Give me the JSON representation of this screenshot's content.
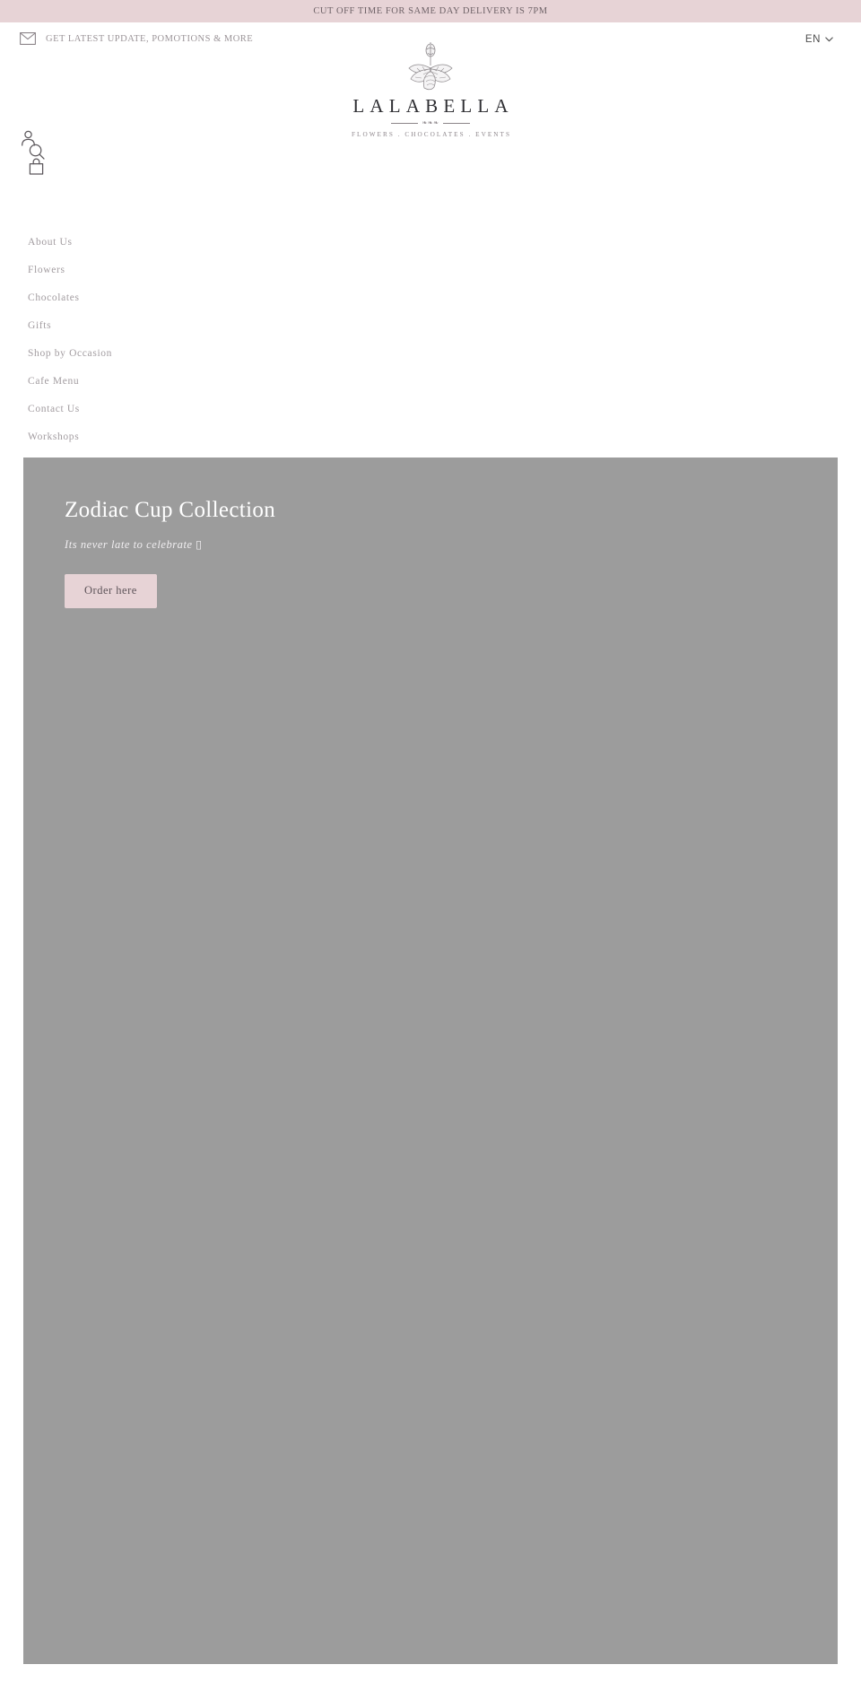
{
  "announcement": {
    "text": "CUT OFF TIME FOR SAME DAY DELIVERY IS 7PM",
    "background_color": "#e7d3d6",
    "text_color": "#6f6368"
  },
  "utility": {
    "newsletter": {
      "icon": "mail-icon",
      "label": "GET LATEST UPDATE, POMOTIONS & MORE"
    },
    "language": {
      "selected": "EN",
      "icon": "chevron-down-icon",
      "options": [
        "EN"
      ]
    }
  },
  "logo": {
    "icon": "flower-logo-icon",
    "wordmark": "LALABELLA",
    "ornament": "❧❧❧",
    "tagline": "FLOWERS . CHOCOLATES . EVENTS"
  },
  "icons": {
    "account": {
      "name": "account-icon",
      "label": "Account"
    },
    "search": {
      "name": "search-icon",
      "label": "Search"
    },
    "bag": {
      "name": "shopping-bag-icon",
      "label": "Cart"
    }
  },
  "nav": {
    "items": [
      {
        "label": "About Us"
      },
      {
        "label": "Flowers"
      },
      {
        "label": "Chocolates"
      },
      {
        "label": "Gifts"
      },
      {
        "label": "Shop by Occasion"
      },
      {
        "label": "Cafe Menu"
      },
      {
        "label": "Contact Us"
      },
      {
        "label": "Workshops"
      }
    ]
  },
  "hero": {
    "title": "Zodiac Cup Collection",
    "subtitle": "Its never late to celebrate ▯",
    "cta_label": "Order here",
    "background_color": "#9c9c9c",
    "cta_background_color": "#e7d3d6",
    "title_color": "#ffffff"
  }
}
